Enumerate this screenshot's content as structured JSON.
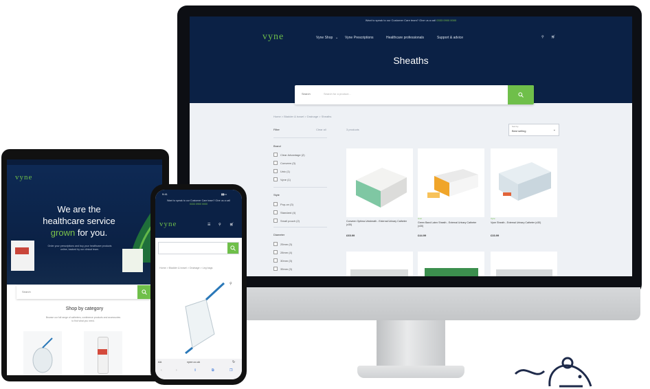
{
  "colors": {
    "navy": "#0b2145",
    "green": "#6fbf4a",
    "page": "#eef1f5"
  },
  "desktop": {
    "topbar": {
      "text": "Want to speak to our Customer Care team? Give us a call",
      "phone": "0333 0900 0000"
    },
    "logo": "vyne",
    "nav": [
      "Vyne Shop",
      "Vyne Prescriptions",
      "Healthcare professionals",
      "Support & advice"
    ],
    "nav_icons": [
      "user-icon",
      "cart-icon"
    ],
    "page_title": "Sheaths",
    "search": {
      "label": "Search",
      "placeholder": "Search for a product..."
    },
    "breadcrumb": "Home  >  Bladder & bowel  >  Drainage  >  Sheaths",
    "filter_label": "Filter",
    "clear_label": "Clear all",
    "results": "3 products",
    "sort": {
      "label": "Sort by",
      "value": "Best selling"
    },
    "filters": [
      {
        "heading": "Brand",
        "options": [
          "Clear Advantage (2)",
          "Conveen (3)",
          "Unic (1)",
          "Vyne (1)"
        ]
      },
      {
        "heading": "Style",
        "options": [
          "Pop-on (3)",
          "Standard (4)",
          "Small pouch (2)"
        ]
      },
      {
        "heading": "Diameter",
        "options": [
          "25mm (3)",
          "28mm (4)",
          "30mm (3)",
          "35mm (3)"
        ]
      }
    ],
    "products": [
      {
        "brand": "",
        "name": "Conveen Optima Unisheath - External Urinary Catheter (x30)",
        "price": "£65.99"
      },
      {
        "brand": "Unic",
        "name": "Green Band Latex Sheath - External Urinary Catheter (x30)",
        "price": "£44.99"
      },
      {
        "brand": "Vyne",
        "name": "Vyne Sheath - External Urinary Catheter (x30)",
        "price": "£33.99"
      }
    ]
  },
  "tablet": {
    "logo": "vyne",
    "headline_1": "We are the",
    "headline_2": "healthcare service",
    "headline_green": "grown",
    "headline_3": "for you.",
    "subtext": "Order your prescriptions and buy your healthcare products online, backed by our clinical team.",
    "search_label": "Search",
    "shop_title": "Shop by category",
    "shop_sub": "Browse our full range of catheters, continence products and accessories to find what you need."
  },
  "phone": {
    "time": "9:41",
    "notice": "Want to speak to our Customer Care team? Give us a call",
    "phone_number": "0333 0900 0000",
    "logo": "vyne",
    "breadcrumb": "Home  >  Bladder & bowel  >  Drainage  >  Leg bags",
    "url": "vyne.co.uk"
  }
}
